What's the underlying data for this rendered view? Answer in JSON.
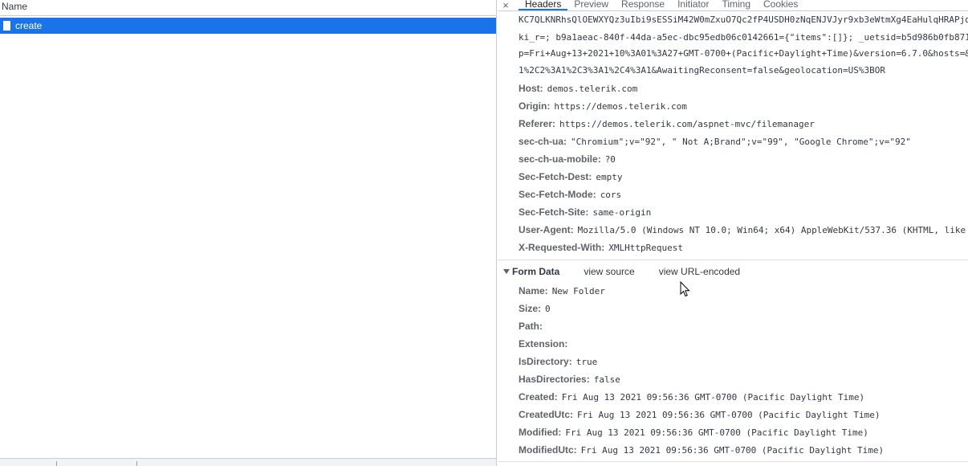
{
  "network": {
    "name_header": "Name",
    "request": {
      "name": "create"
    }
  },
  "tabs": {
    "close": "×",
    "items": [
      "Headers",
      "Preview",
      "Response",
      "Initiator",
      "Timing",
      "Cookies"
    ]
  },
  "headers": {
    "cookie_lines": [
      "KC7QLKNRhsQlOEWXYQz3uIbi9sESSiM42W0mZxuO7Qc2fP4USDH0zNqENJVJyr9xb3eWtmXg4EaHulqHRAPjd",
      "ki_r=; b9a1aeac-840f-44da-a5ec-dbc95edb06c0142661={\"items\":[]}; _uetsid=b5d986b0fb871",
      "p=Fri+Aug+13+2021+10%3A01%3A27+GMT-0700+(Pacific+Daylight+Time)&version=6.7.0&hosts=&",
      "1%2C2%3A1%2C3%3A1%2C4%3A1&AwaitingReconsent=false&geolocation=US%3BOR"
    ],
    "rows": [
      {
        "key": "Host:",
        "value": "demos.telerik.com"
      },
      {
        "key": "Origin:",
        "value": "https://demos.telerik.com"
      },
      {
        "key": "Referer:",
        "value": "https://demos.telerik.com/aspnet-mvc/filemanager"
      },
      {
        "key": "sec-ch-ua:",
        "value": "\"Chromium\";v=\"92\", \" Not A;Brand\";v=\"99\", \"Google Chrome\";v=\"92\""
      },
      {
        "key": "sec-ch-ua-mobile:",
        "value": "?0"
      },
      {
        "key": "Sec-Fetch-Dest:",
        "value": "empty"
      },
      {
        "key": "Sec-Fetch-Mode:",
        "value": "cors"
      },
      {
        "key": "Sec-Fetch-Site:",
        "value": "same-origin"
      },
      {
        "key": "User-Agent:",
        "value": "Mozilla/5.0 (Windows NT 10.0; Win64; x64) AppleWebKit/537.36 (KHTML, like"
      },
      {
        "key": "X-Requested-With:",
        "value": "XMLHttpRequest"
      }
    ]
  },
  "form_data": {
    "title": "Form Data",
    "view_source": "view source",
    "view_url_encoded": "view URL-encoded",
    "rows": [
      {
        "key": "Name:",
        "value": "New Folder"
      },
      {
        "key": "Size:",
        "value": "0"
      },
      {
        "key": "Path:",
        "value": ""
      },
      {
        "key": "Extension:",
        "value": ""
      },
      {
        "key": "IsDirectory:",
        "value": "true"
      },
      {
        "key": "HasDirectories:",
        "value": "false"
      },
      {
        "key": "Created:",
        "value": "Fri Aug 13 2021 09:56:36 GMT-0700 (Pacific Daylight Time)"
      },
      {
        "key": "CreatedUtc:",
        "value": "Fri Aug 13 2021 09:56:36 GMT-0700 (Pacific Daylight Time)"
      },
      {
        "key": "Modified:",
        "value": "Fri Aug 13 2021 09:56:36 GMT-0700 (Pacific Daylight Time)"
      },
      {
        "key": "ModifiedUtc:",
        "value": "Fri Aug 13 2021 09:56:36 GMT-0700 (Pacific Daylight Time)"
      }
    ]
  },
  "colors": {
    "selected_row": "#1a73e8",
    "active_tab_underline": "#1a73e8",
    "key_text": "#5f6368",
    "value_text": "#303942"
  }
}
